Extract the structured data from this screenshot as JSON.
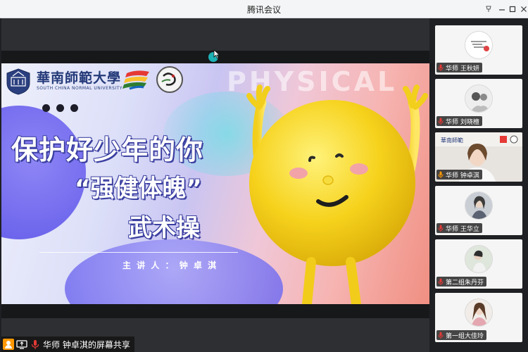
{
  "window": {
    "title": "腾讯会议"
  },
  "slide": {
    "watermark": "PHYSICAL",
    "university_name": "華南師範大學",
    "university_en": "SOUTH CHINA NORMAL UNIVERSITY",
    "title_line1": "保护好少年的你",
    "title_line2": "“强健体魄”",
    "title_line3": "武术操",
    "presenter": "主 讲 人 ： 钟 卓 淇"
  },
  "participants": [
    {
      "name": "华师 王秋妍",
      "active": false
    },
    {
      "name": "华师 刘晓檀",
      "active": false
    },
    {
      "name": "华师 钟卓淇",
      "active": true
    },
    {
      "name": "华师 王华立",
      "active": false
    },
    {
      "name": "第二组朱丹芬",
      "active": false
    },
    {
      "name": "第一组大佳玲",
      "active": false
    }
  ],
  "share_status": "华师 钟卓淇的屏幕共享",
  "colors": {
    "accent": "#1db2b5",
    "title_stroke": "#3b3fa0",
    "mascot": "#f4d21c"
  }
}
